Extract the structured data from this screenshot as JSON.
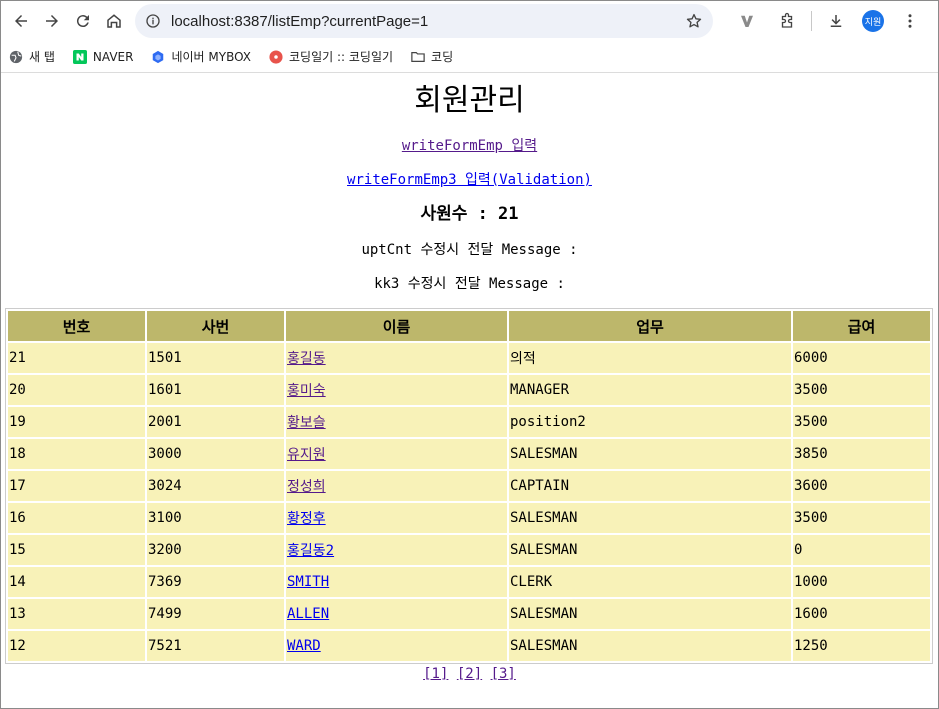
{
  "browser": {
    "url": "localhost:8387/listEmp?currentPage=1",
    "profile_initials": "지원",
    "bookmarks": [
      {
        "label": "새 탭",
        "icon": "globe-icon"
      },
      {
        "label": "NAVER",
        "icon": "naver-icon"
      },
      {
        "label": "네이버 MYBOX",
        "icon": "mybox-icon"
      },
      {
        "label": "코딩일기 :: 코딩일기",
        "icon": "blog-icon"
      },
      {
        "label": "코딩",
        "icon": "folder-icon"
      }
    ]
  },
  "page": {
    "title": "회원관리",
    "link1": "writeFormEmp 입력",
    "link2": "writeFormEmp3 입력(Validation)",
    "count_label": "사원수 : 21",
    "msg1": "uptCnt 수정시 전달 Message :",
    "msg2": "kk3 수정시 전달 Message :"
  },
  "table": {
    "headers": [
      "번호",
      "사번",
      "이름",
      "업무",
      "급여"
    ],
    "rows": [
      [
        "21",
        "1501",
        "홍길동",
        "의적",
        "6000"
      ],
      [
        "20",
        "1601",
        "홍미숙",
        "MANAGER",
        "3500"
      ],
      [
        "19",
        "2001",
        "황보슬",
        "position2",
        "3500"
      ],
      [
        "18",
        "3000",
        "유지원",
        "SALESMAN",
        "3850"
      ],
      [
        "17",
        "3024",
        "정성희",
        "CAPTAIN",
        "3600"
      ],
      [
        "16",
        "3100",
        "황정후",
        "SALESMAN",
        "3500"
      ],
      [
        "15",
        "3200",
        "홍길동2",
        "SALESMAN",
        "0"
      ],
      [
        "14",
        "7369",
        "SMITH",
        "CLERK",
        "1000"
      ],
      [
        "13",
        "7499",
        "ALLEN",
        "SALESMAN",
        "1600"
      ],
      [
        "12",
        "7521",
        "WARD",
        "SALESMAN",
        "1250"
      ]
    ]
  },
  "pager": [
    "[1]",
    "[2]",
    "[3]"
  ]
}
